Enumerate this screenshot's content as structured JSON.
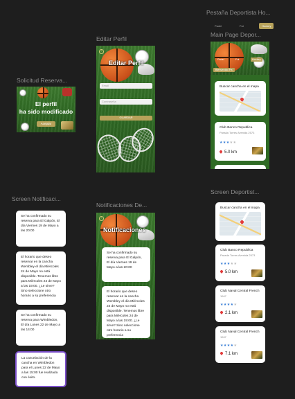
{
  "frames": {
    "pestana": "Pestaña Deportista Ho...",
    "editar": "Editar Perfil",
    "main": "Main Page Depor...",
    "solicitud": "Solicitud Reserva...",
    "screen_notif": "Screen Notificaci...",
    "notif_dep": "Notificaciones De...",
    "screen_dep": "Screen Deportist..."
  },
  "pestana_tabs": [
    "Padel",
    "Fut",
    "Hockey"
  ],
  "editar_perfil": {
    "title": "Editar Perfil",
    "fields": [
      "Email",
      "Contraseña"
    ],
    "button": "GUARDAR"
  },
  "solicitud": {
    "line1": "El perfil",
    "line2": "ha sido modificado",
    "button": "Aceptar"
  },
  "main_page": {
    "tabs": [
      "Padel",
      "Fut",
      "Hockey"
    ],
    "welcome": "Bienvenido Pa",
    "search": "Buscar cancha en el mapa",
    "venue_name": "Club Banco Republica",
    "venue_addr": "Parada Torres Avenida 2573",
    "rating": 3.5,
    "distance": "5.0 km"
  },
  "notifications": [
    "Se ha confirmado su reserva para El Galpón, El día Viernes 19 de Mayo a las 20:00",
    "El horario que deseo reservar en la cancha Wembley el día Miércoles 24 de Mayo no está disponible. Tenemos libre para Miércoles 24 de Mayo a las 19:00. ¿Le sirve? Sino seleccione otro horario a su preferencia",
    "Se ha confirmado su reserva para Wimbledon, El día Lunes 22 de Mayo a las 14:00",
    "La cancelación de la cancha en Wimbledon para el Lunes 22 de Mayo a las 15:00 fue realizada con éxito."
  ],
  "notif_screen": {
    "title": "Notificaciones",
    "items": [
      "Se ha confirmado su reserva para El Galpón, El día Viernes 19 de Mayo a las 20:00",
      "El horario que deseo reservar en la cancha Wembley el día Miércoles 24 de Mayo no está disponible. Tenemos libre para Miércoles 24 de Mayo a las 19:00. ¿Le sirve? Sino seleccione otro horario a su preferencia"
    ]
  },
  "screen_dep": {
    "search": "Buscar cancha en el mapa",
    "venues": [
      {
        "name": "Club Banco Republica",
        "addr": "Parada Torres Avenida 2573",
        "rating": 3.5,
        "distance": "5.0 km"
      },
      {
        "name": "Club Naval Central French",
        "addr": "1947",
        "rating": 4,
        "distance": "2.1 km"
      },
      {
        "name": "Club Naval Central French",
        "addr": "1947",
        "rating": 4,
        "distance": "7.1 km"
      }
    ]
  },
  "colors": {
    "accent": "#b7a25a",
    "background": "#1e1e1e",
    "star": "#3a7fd6",
    "pin": "#e23b3b",
    "selected_outline": "#7b4fc9"
  }
}
